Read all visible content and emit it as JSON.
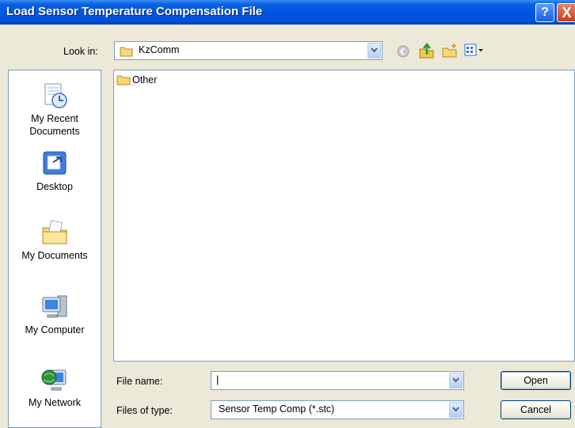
{
  "window": {
    "title": "Load Sensor Temperature Compensation File",
    "help": "?",
    "close": "X"
  },
  "look_in": {
    "label": "Look in:",
    "value": "KzComm"
  },
  "places": [
    {
      "label_line1": "My Recent",
      "label_line2": "Documents"
    },
    {
      "label_line1": "Desktop",
      "label_line2": ""
    },
    {
      "label_line1": "My Documents",
      "label_line2": ""
    },
    {
      "label_line1": "My Computer",
      "label_line2": ""
    },
    {
      "label_line1": "My Network",
      "label_line2": ""
    }
  ],
  "files": [
    {
      "name": "Other",
      "icon": "folder-icon"
    }
  ],
  "file_name": {
    "label": "File name:",
    "value": ""
  },
  "file_type": {
    "label": "Files of type:",
    "value": "Sensor Temp Comp (*.stc)"
  },
  "buttons": {
    "open": "Open",
    "cancel": "Cancel"
  },
  "icons": [
    "folder-icon",
    "back-icon",
    "up-folder-icon",
    "new-folder-icon",
    "views-menu-icon",
    "recent-documents-icon",
    "desktop-icon",
    "my-documents-icon",
    "my-computer-icon",
    "network-icon"
  ],
  "colors": {
    "titlebar": "#0054e3",
    "dialog_bg": "#ece9d8",
    "field_border": "#7f9db9"
  }
}
